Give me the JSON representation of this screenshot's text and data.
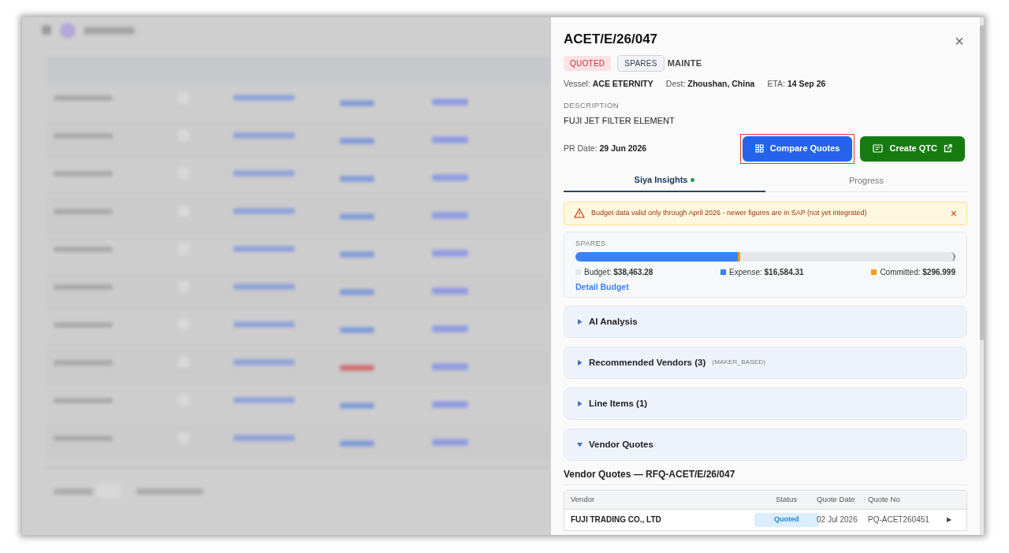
{
  "panel": {
    "title": "ACET/E/26/047",
    "close": "×",
    "badges": [
      {
        "text": "QUOTED",
        "kind": "status"
      },
      {
        "text": "SPARES",
        "kind": "category"
      },
      {
        "text": "MAINTE",
        "kind": "plain"
      }
    ],
    "meta": [
      {
        "label": "Vessel:",
        "value": "ACE ETERNITY"
      },
      {
        "label": "Dest:",
        "value": "Zhoushan, China"
      },
      {
        "label": "ETA:",
        "value": "14 Sep 26"
      }
    ],
    "description_label": "DESCRIPTION",
    "description": "FUJI JET FILTER ELEMENT",
    "pr_date": {
      "label": "PR Date:",
      "value": "29 Jun 2026"
    },
    "buttons": [
      {
        "label": "Compare Quotes",
        "kind": "primary",
        "highlighted": true
      },
      {
        "label": "Create QTC",
        "kind": "success",
        "highlighted": false
      }
    ],
    "tabs": [
      {
        "label": "Siya Insights",
        "selected": true,
        "dot": true
      },
      {
        "label": "Progress",
        "selected": false,
        "dot": false
      }
    ],
    "alert": {
      "text": "Budget data valid only through April 2026 - newer figures are in SAP (not yet integrated)",
      "close": "×"
    },
    "budget": {
      "title": "SPARES",
      "segments": [
        {
          "level": 0.43,
          "color": "#3b82f6"
        },
        {
          "level": 0.004,
          "color": "#f59e0b"
        }
      ],
      "legend": [
        {
          "label": "Budget:",
          "value": "$38,463.28",
          "color": "#e5e7eb"
        },
        {
          "label": "Expense:",
          "value": "$16,584.31",
          "color": "#3b82f6"
        },
        {
          "label": "Committed:",
          "value": "$296.999",
          "color": "#f59e0b"
        }
      ],
      "link": "Detail Budget"
    },
    "sections": [
      {
        "title": "AI Analysis",
        "expanded": false
      },
      {
        "title": "Recommended Vendors (3)",
        "note": "(MAKER_BASED)",
        "expanded": false
      },
      {
        "title": "Line Items (1)",
        "expanded": false
      },
      {
        "title": "Vendor Quotes",
        "expanded": true
      }
    ],
    "quotes": {
      "title": "Vendor Quotes — RFQ-ACET/E/26/047",
      "columns": [
        "Vendor",
        "Status",
        "Quote Date",
        "Quote No"
      ],
      "rows": [
        {
          "vendor": "FUJI TRADING CO., LTD",
          "status": "Quoted",
          "date": "02 Jul 2026",
          "number": "PQ-ACET260451",
          "open": "▶"
        }
      ]
    }
  }
}
